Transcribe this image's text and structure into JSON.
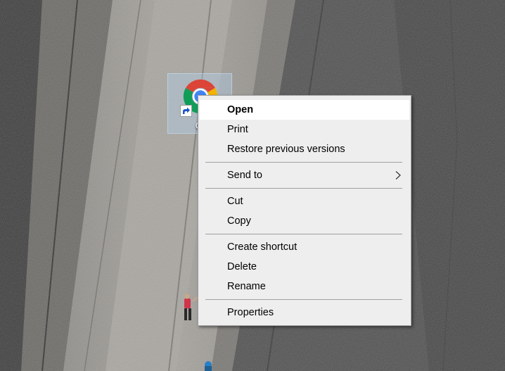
{
  "desktop": {
    "icon": {
      "label": "Gr",
      "icon_name": "chrome-icon",
      "overlay_name": "shortcut-arrow-icon"
    }
  },
  "context_menu": {
    "groups": [
      [
        {
          "label": "Open",
          "default": true
        },
        {
          "label": "Print"
        },
        {
          "label": "Restore previous versions"
        }
      ],
      [
        {
          "label": "Send to",
          "submenu": true
        }
      ],
      [
        {
          "label": "Cut"
        },
        {
          "label": "Copy"
        }
      ],
      [
        {
          "label": "Create shortcut"
        },
        {
          "label": "Delete"
        },
        {
          "label": "Rename"
        }
      ],
      [
        {
          "label": "Properties"
        }
      ]
    ]
  },
  "colors": {
    "menu_background": "#eeeeee",
    "menu_highlight": "#ffffff",
    "menu_border": "#a0a0a0",
    "chrome_red": "#db4437",
    "chrome_green": "#0f9d58",
    "chrome_yellow": "#f4b400",
    "chrome_blue": "#4285f4"
  }
}
